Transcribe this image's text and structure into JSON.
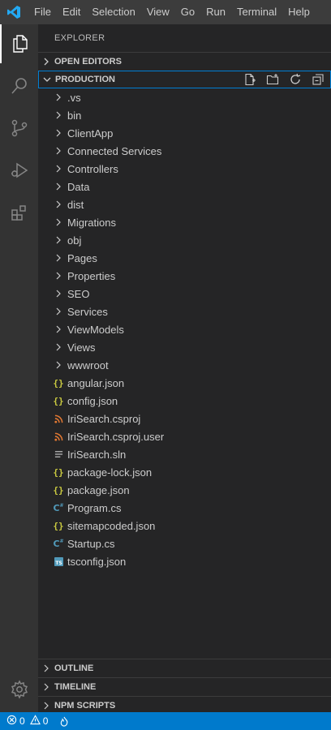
{
  "menu": [
    "File",
    "Edit",
    "Selection",
    "View",
    "Go",
    "Run",
    "Terminal",
    "Help"
  ],
  "explorer": {
    "title": "EXPLORER",
    "open_editors": "OPEN EDITORS",
    "workspace": "PRODUCTION",
    "folders": [
      ".vs",
      "bin",
      "ClientApp",
      "Connected Services",
      "Controllers",
      "Data",
      "dist",
      "Migrations",
      "obj",
      "Pages",
      "Properties",
      "SEO",
      "Services",
      "ViewModels",
      "Views",
      "wwwroot"
    ],
    "files": [
      {
        "name": "angular.json",
        "icon": "json-braces-icon"
      },
      {
        "name": "config.json",
        "icon": "json-braces-icon"
      },
      {
        "name": "IriSearch.csproj",
        "icon": "rss-icon"
      },
      {
        "name": "IriSearch.csproj.user",
        "icon": "rss-icon"
      },
      {
        "name": "IriSearch.sln",
        "icon": "lines-icon"
      },
      {
        "name": "package-lock.json",
        "icon": "json-braces-icon"
      },
      {
        "name": "package.json",
        "icon": "json-braces-icon"
      },
      {
        "name": "Program.cs",
        "icon": "csharp-icon"
      },
      {
        "name": "sitemapcoded.json",
        "icon": "json-braces-icon"
      },
      {
        "name": "Startup.cs",
        "icon": "csharp-icon"
      },
      {
        "name": "tsconfig.json",
        "icon": "typescript-icon"
      }
    ],
    "bottom_sections": [
      "OUTLINE",
      "TIMELINE",
      "NPM SCRIPTS"
    ]
  },
  "status": {
    "errors": "0",
    "warnings": "0"
  },
  "colors": {
    "json": "#cbcb41",
    "rss": "#e37933",
    "csharp": "#519aba",
    "ts": "#519aba",
    "accent": "#007acc"
  }
}
